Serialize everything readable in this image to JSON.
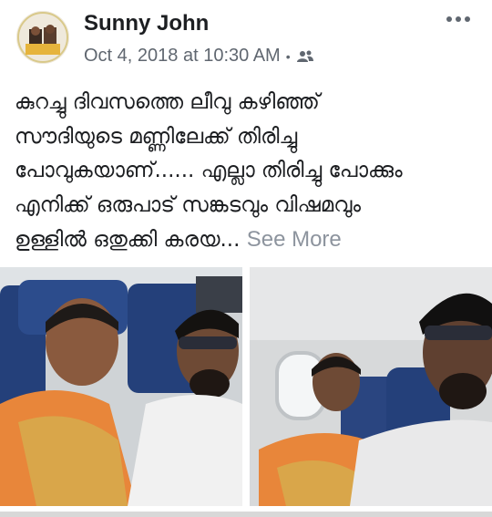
{
  "post": {
    "author": "Sunny John",
    "timestamp": "Oct 4, 2018 at 10:30 AM",
    "separator": "•",
    "audience_icon": "friends-icon",
    "more_icon": "more-options-icon",
    "text_lines": [
      "കുറച്ചു ദിവസത്തെ ലീവു കഴിഞ്ഞ്",
      "സൗദിയുടെ മണ്ണിലേക്ക് തിരിച്ചു",
      "പോവുകയാണ്...... എല്ലാ തിരിച്ചു പോക്കും",
      "എനിക്ക് ഒരുപാട് സങ്കടവും വിഷമവും",
      "ഉള്ളിൽ ഒതുക്കി കരയ..."
    ],
    "see_more": "See More"
  },
  "colors": {
    "name": "#1c1e21",
    "meta": "#606770",
    "see_more": "#8d949e",
    "saree": "#e8863a",
    "seat": "#24407a"
  }
}
